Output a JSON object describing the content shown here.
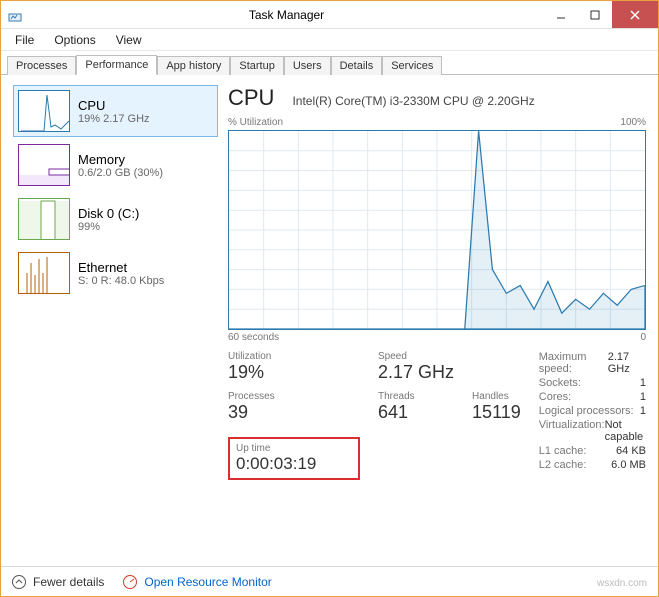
{
  "window": {
    "title": "Task Manager"
  },
  "menu": [
    "File",
    "Options",
    "View"
  ],
  "tabs": [
    "Processes",
    "Performance",
    "App history",
    "Startup",
    "Users",
    "Details",
    "Services"
  ],
  "active_tab": 1,
  "sidebar": [
    {
      "name": "CPU",
      "sub": "19% 2.17 GHz",
      "color": "#2a7ab0"
    },
    {
      "name": "Memory",
      "sub": "0.6/2.0 GB (30%)",
      "color": "#7a2a9e"
    },
    {
      "name": "Disk 0 (C:)",
      "sub": "99%",
      "color": "#6aa84f"
    },
    {
      "name": "Ethernet",
      "sub": "S: 0 R: 48.0 Kbps",
      "color": "#b45f06"
    }
  ],
  "header": {
    "title": "CPU",
    "subtitle": "Intel(R) Core(TM) i3-2330M CPU @ 2.20GHz"
  },
  "chart": {
    "left_label": "% Utilization",
    "right_label": "100%",
    "x_start": "60 seconds",
    "x_end": "0"
  },
  "stats_left": [
    {
      "label": "Utilization",
      "value": "19%"
    },
    {
      "label": "Processes",
      "value": "39"
    }
  ],
  "stats_mid": [
    {
      "label": "Speed",
      "value": "2.17 GHz"
    },
    {
      "label": "Threads",
      "value": "641"
    }
  ],
  "stats_last": [
    {
      "label": "Handles",
      "value": "15119"
    }
  ],
  "stats_right": [
    {
      "k": "Maximum speed:",
      "v": "2.17 GHz"
    },
    {
      "k": "Sockets:",
      "v": "1"
    },
    {
      "k": "Cores:",
      "v": "1"
    },
    {
      "k": "Logical processors:",
      "v": "1"
    },
    {
      "k": "Virtualization:",
      "v": "Not capable"
    },
    {
      "k": "L1 cache:",
      "v": "64 KB"
    },
    {
      "k": "L2 cache:",
      "v": "6.0 MB"
    }
  ],
  "uptime": {
    "label": "Up time",
    "value": "0:00:03:19"
  },
  "footer": {
    "fewer": "Fewer details",
    "monitor": "Open Resource Monitor"
  },
  "watermark": "wsxdn.com",
  "chart_data": {
    "type": "line",
    "title": "% Utilization",
    "ylabel": "% Utilization",
    "xlabel": "seconds ago",
    "ylim": [
      0,
      100
    ],
    "xlim": [
      60,
      0
    ],
    "x": [
      60,
      58,
      56,
      54,
      52,
      50,
      48,
      46,
      44,
      42,
      40,
      38,
      36,
      34,
      32,
      30,
      28,
      26,
      24,
      22,
      20,
      18,
      16,
      14,
      12,
      10,
      8,
      6,
      4,
      2,
      0
    ],
    "values": [
      0,
      0,
      0,
      0,
      0,
      0,
      0,
      0,
      0,
      0,
      0,
      0,
      0,
      0,
      0,
      0,
      0,
      0,
      100,
      30,
      18,
      22,
      10,
      24,
      8,
      15,
      10,
      18,
      12,
      20,
      22
    ]
  }
}
